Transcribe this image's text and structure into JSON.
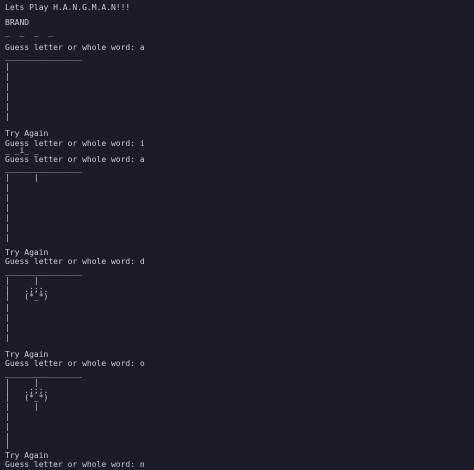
{
  "colors": {
    "background": "#1c1c28",
    "text": "#c9cbd6"
  },
  "lines": [
    "Lets Play H.A.N.G.M.A.N!!!",
    "BRAND",
    "_  _  _  _",
    "Guess letter or whole word: a",
    "________________",
    "|",
    "|",
    "|",
    "|",
    "|",
    "|",
    "Try Again",
    "Guess letter or whole word: i",
    "_ _i_ _",
    "Guess letter or whole word: a",
    "________________",
    "|     |",
    "|",
    "|",
    "|",
    "|",
    "|",
    "|",
    "Try Again",
    "Guess letter or whole word: d",
    "________________",
    "|     |",
    "|   .;;;.",
    "|   (*_*)",
    "|",
    "|",
    "|",
    "|",
    "Try Again",
    "Guess letter or whole word: o",
    "________________",
    "|     |",
    "|   .;;;.",
    "|   (*_*)",
    "|     |",
    "|",
    "|",
    "|",
    "|",
    "Try Again",
    "Guess letter or whole word: n"
  ]
}
